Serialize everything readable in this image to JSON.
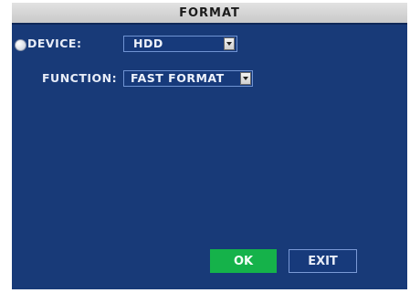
{
  "title": "FORMAT",
  "rows": [
    {
      "label": "DEVICE:",
      "value": "HDD",
      "selected": true
    },
    {
      "label": "FUNCTION:",
      "value": "FAST FORMAT",
      "selected": false
    }
  ],
  "buttons": {
    "ok_label": "OK",
    "exit_label": "EXIT"
  },
  "colors": {
    "background": "#183a78",
    "title_bar": "#d4d4d4",
    "ok_button": "#15b24a",
    "border": "#6f93d2"
  },
  "icons": {
    "selection_marker": "radio-dot-icon",
    "dropdown": "chevron-down-icon"
  }
}
